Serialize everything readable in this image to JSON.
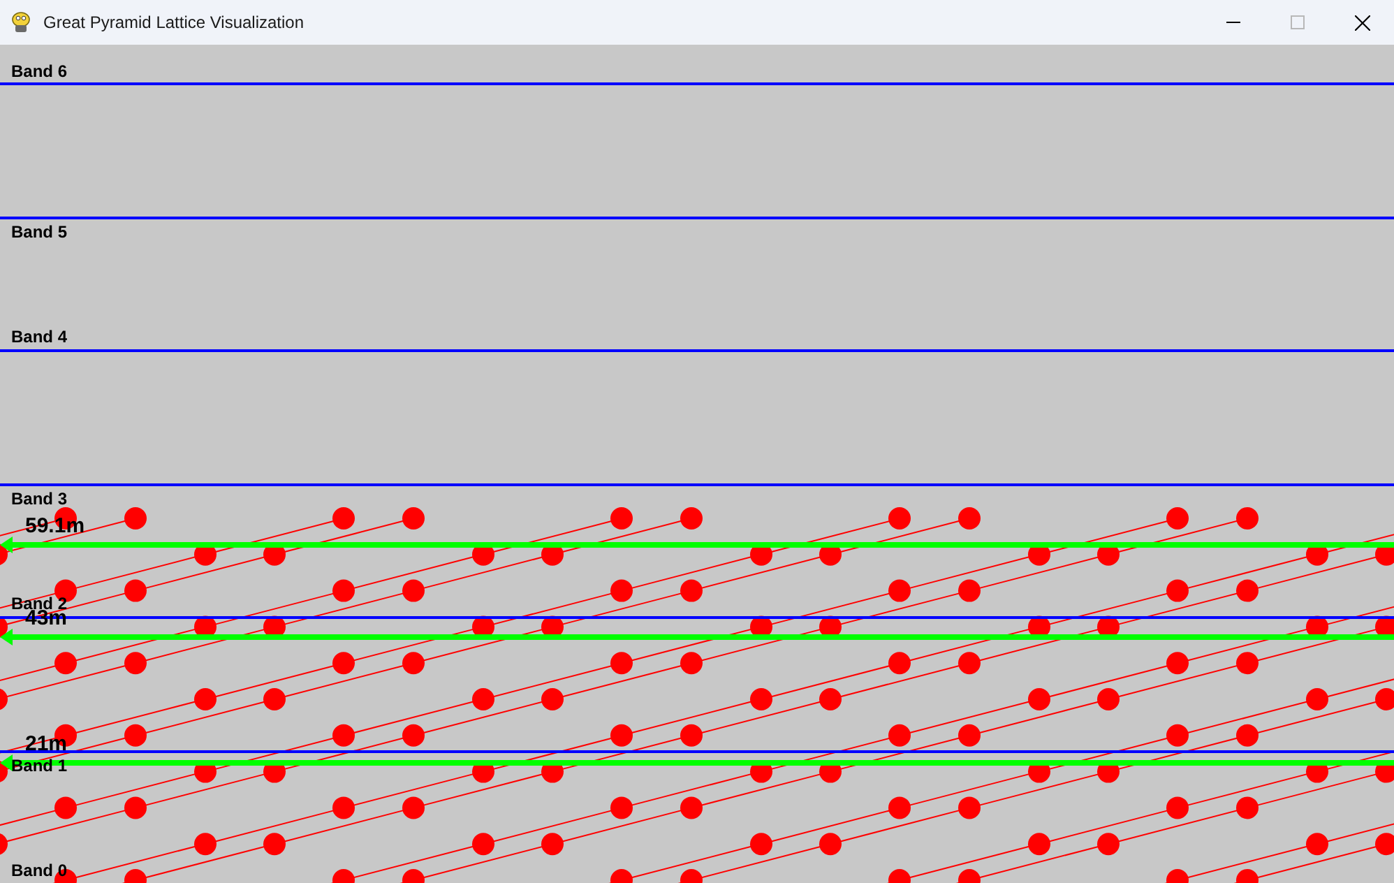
{
  "window": {
    "title": "Great Pyramid Lattice Visualization"
  },
  "bands": [
    {
      "label": "Band 6"
    },
    {
      "label": "Band 5"
    },
    {
      "label": "Band 4"
    },
    {
      "label": "Band 3"
    },
    {
      "label": "Band 2"
    },
    {
      "label": "Band 1"
    },
    {
      "label": "Band 0"
    }
  ],
  "levels": [
    {
      "label": "59.1m"
    },
    {
      "label": "43m"
    },
    {
      "label": "21m"
    }
  ]
}
